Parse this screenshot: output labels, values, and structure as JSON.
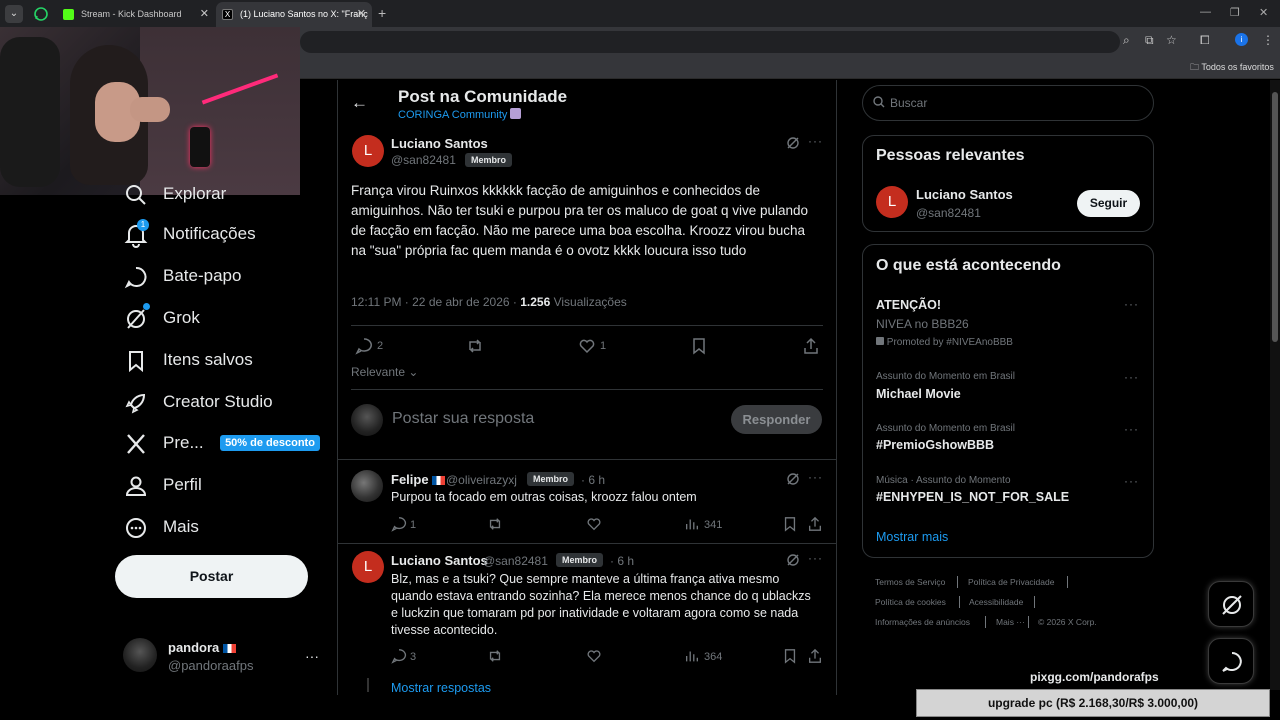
{
  "browser": {
    "tabs": [
      {
        "title": "Stream - Kick Dashboard"
      },
      {
        "title": "(1) Luciano Santos no X: \"Franç"
      }
    ],
    "bookmarks_folder": "Todos os favoritos",
    "colors": {
      "kick_green": "#53fc18",
      "x_blue": "#1d9bf0"
    }
  },
  "nav": {
    "items": [
      {
        "label": "Explorar",
        "icon": "search-icon"
      },
      {
        "label": "Notificações",
        "icon": "bell-icon",
        "badge": "1"
      },
      {
        "label": "Bate-papo",
        "icon": "chat-icon"
      },
      {
        "label": "Grok",
        "icon": "grok-icon"
      },
      {
        "label": "Itens salvos",
        "icon": "bookmark-icon"
      },
      {
        "label": "Creator Studio",
        "icon": "rocket-icon"
      },
      {
        "label": "Pre...",
        "icon": "x-logo-icon",
        "promo": "50% de desconto"
      },
      {
        "label": "Perfil",
        "icon": "person-icon"
      },
      {
        "label": "Mais",
        "icon": "more-circle-icon"
      }
    ],
    "post_button": "Postar",
    "account": {
      "name": "pandora",
      "handle": "@pandoraafps"
    }
  },
  "header": {
    "title": "Post na Comunidade",
    "community": "CORINGA Community"
  },
  "post": {
    "avatar_letter": "L",
    "author": "Luciano Santos",
    "handle": "@san82481",
    "member_badge": "Membro",
    "text": "França virou Ruinxos kkkkkk facção de amiguinhos e conhecidos de amiguinhos. Não ter tsuki e purpou pra ter os maluco de goat q vive pulando de facção em facção. Não me parece uma boa escolha. Kroozz virou bucha na \"sua\" própria fac quem manda é o ovotz kkkk loucura isso tudo",
    "time": "12:11 PM · 22 de abr de 2026 · ",
    "views_count": "1.256",
    "views_label": " Visualizações",
    "replies": "2",
    "likes": "1",
    "sort_label": "Relevante"
  },
  "composer": {
    "placeholder": "Postar sua resposta",
    "button": "Responder"
  },
  "replies": [
    {
      "author": "Felipe",
      "handle": "@oliveirazyxj",
      "badge": "Membro",
      "time": "6 h",
      "text": "Purpou ta focado em outras coisas, kroozz falou ontem",
      "replies": "1",
      "views": "341"
    },
    {
      "avatar_letter": "L",
      "author": "Luciano Santos",
      "handle": "@san82481",
      "badge": "Membro",
      "time": "6 h",
      "text": "Blz, mas e a tsuki? Que sempre manteve a última frança ativa mesmo quando estava entrando sozinha? Ela merece menos chance do q ublackzs e luckzin que tomaram pd por inatividade e voltaram agora como se nada tivesse acontecido.",
      "replies": "3",
      "views": "364"
    }
  ],
  "show_replies": "Mostrar respostas",
  "search": {
    "placeholder": "Buscar"
  },
  "relevant_people": {
    "title": "Pessoas relevantes",
    "person": {
      "avatar_letter": "L",
      "name": "Luciano Santos",
      "handle": "@san82481",
      "button": "Seguir"
    }
  },
  "trending": {
    "title": "O que está acontecendo",
    "items": [
      {
        "name": "ATENÇÃO!",
        "sub": "NIVEA no BBB26",
        "promo": "Promoted by #NIVEAnoBBB"
      },
      {
        "category": "Assunto do Momento em Brasil",
        "name": "Michael Movie"
      },
      {
        "category": "Assunto do Momento em Brasil",
        "name": "#PremioGshowBBB"
      },
      {
        "category": "Música · Assunto do Momento",
        "name": "#ENHYPEN_IS_NOT_FOR_SALE"
      }
    ],
    "show_more": "Mostrar mais"
  },
  "footer": {
    "links": [
      "Termos de Serviço",
      "Política de Privacidade",
      "Política de cookies",
      "Acessibilidade",
      "Informações de anúncios",
      "Mais ···",
      "© 2026 X Corp."
    ]
  },
  "overlay": {
    "url": "pixgg.com/pandorafps",
    "goal": "upgrade pc (R$ 2.168,30/R$ 3.000,00)"
  }
}
